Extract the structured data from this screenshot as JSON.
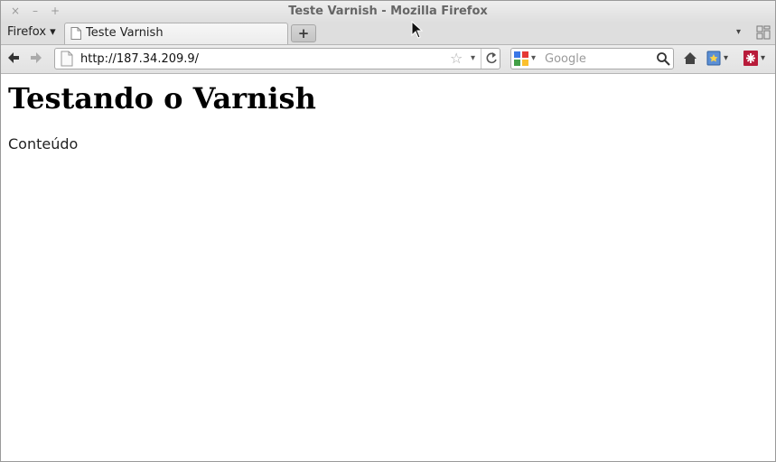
{
  "window": {
    "title": "Teste Varnish - Mozilla Firefox",
    "controls": {
      "close": "×",
      "minimize": "–",
      "maximize": "+"
    }
  },
  "tabbar": {
    "menu_label": "Firefox ▾",
    "tabs": [
      {
        "label": "Teste Varnish",
        "active": true
      }
    ],
    "new_tab_label": "+",
    "tab_list_label": "▾"
  },
  "navbar": {
    "url": "http://187.34.209.9/",
    "search_placeholder": "Google",
    "search_engine": "Google",
    "dropdown_glyph": "▾"
  },
  "page": {
    "heading": "Testando o Varnish",
    "paragraph": "Conteúdo"
  },
  "colors": {
    "chrome": "#dedede",
    "border": "#b5b5b5",
    "home_icon": "#444444",
    "addon": "#b81b3a"
  }
}
